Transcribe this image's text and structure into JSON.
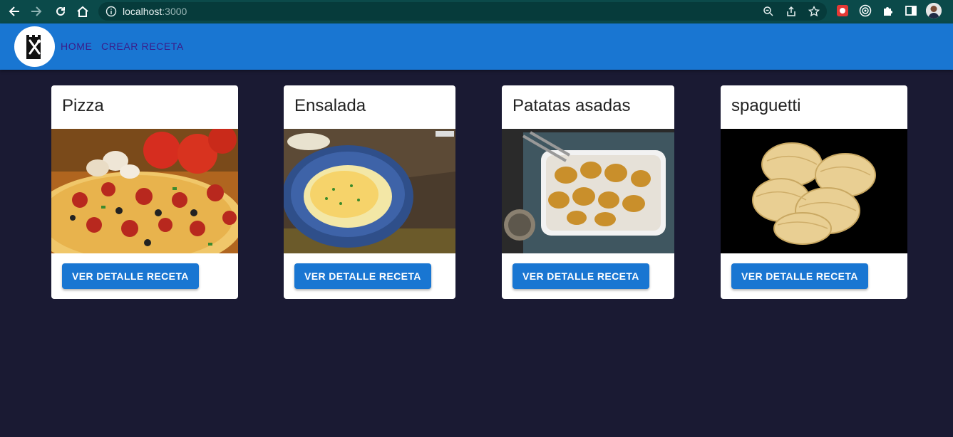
{
  "browser": {
    "url_host": "localhost",
    "url_port": ":3000"
  },
  "nav": {
    "home": "HOME",
    "create": "CREAR RECETA"
  },
  "cards": [
    {
      "title": "Pizza",
      "button": "VER DETALLE RECETA"
    },
    {
      "title": "Ensalada",
      "button": "VER DETALLE RECETA"
    },
    {
      "title": "Patatas asadas",
      "button": "VER DETALLE RECETA"
    },
    {
      "title": "spaguetti",
      "button": "VER DETALLE RECETA"
    }
  ],
  "colors": {
    "page_bg": "#1a1a33",
    "appbar": "#1976d2",
    "nav_link": "#3a1d8a",
    "button": "#1976d2"
  }
}
